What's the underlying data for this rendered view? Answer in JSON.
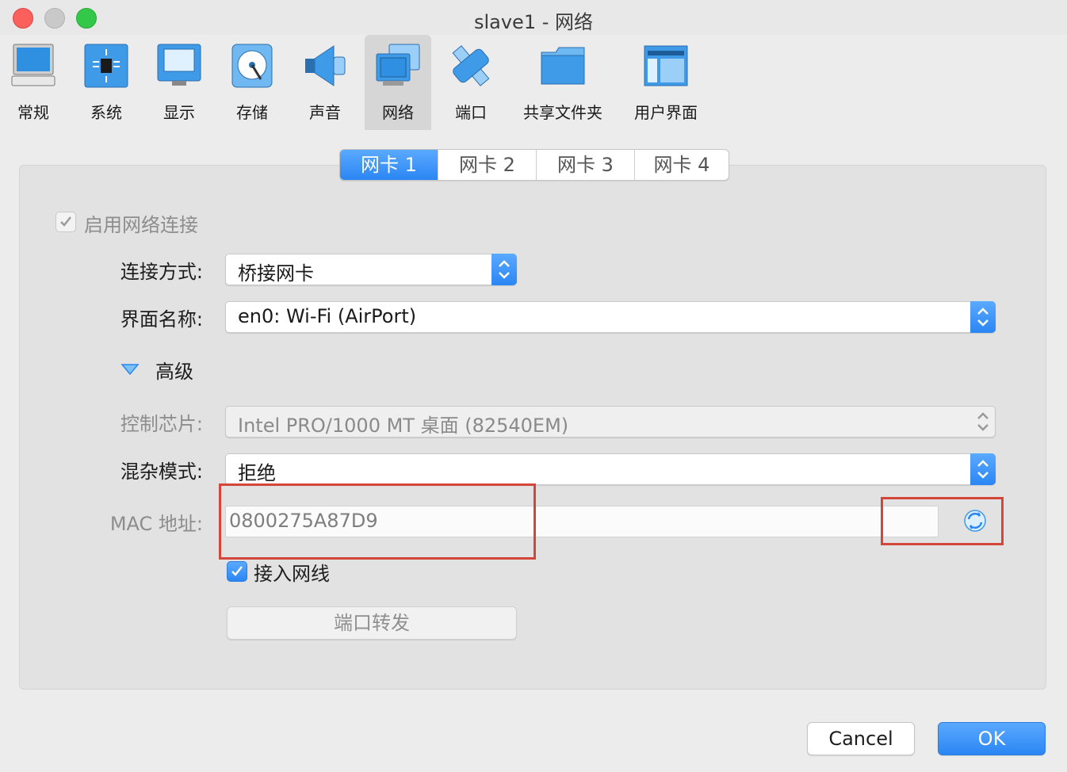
{
  "window": {
    "title": "slave1 - 网络"
  },
  "toolbar": {
    "items": [
      {
        "label": "常规",
        "icon": "monitor-general-icon"
      },
      {
        "label": "系统",
        "icon": "chip-system-icon"
      },
      {
        "label": "显示",
        "icon": "display-icon"
      },
      {
        "label": "存储",
        "icon": "storage-disk-icon"
      },
      {
        "label": "声音",
        "icon": "speaker-icon"
      },
      {
        "label": "网络",
        "icon": "network-icon",
        "selected": true
      },
      {
        "label": "端口",
        "icon": "serial-port-icon"
      },
      {
        "label": "共享文件夹",
        "icon": "shared-folder-icon"
      },
      {
        "label": "用户界面",
        "icon": "user-interface-icon"
      }
    ]
  },
  "tabs": [
    "网卡 1",
    "网卡 2",
    "网卡 3",
    "网卡 4"
  ],
  "active_tab": "网卡 1",
  "form": {
    "enable_label": "启用网络连接",
    "attach_label": "连接方式:",
    "attach_value": "桥接网卡",
    "name_label": "界面名称:",
    "name_value": "en0: Wi-Fi (AirPort)",
    "advanced_label": "高级",
    "adapter_label": "控制芯片:",
    "adapter_value": "Intel PRO/1000 MT 桌面 (82540EM)",
    "promisc_label": "混杂模式:",
    "promisc_value": "拒绝",
    "mac_label": "MAC 地址:",
    "mac_value": "0800275A87D9",
    "cable_label": "接入网线",
    "port_forward_label": "端口转发"
  },
  "buttons": {
    "cancel": "Cancel",
    "ok": "OK"
  },
  "colors": {
    "accent": "#2b86f3",
    "highlight": "#d4463a"
  }
}
